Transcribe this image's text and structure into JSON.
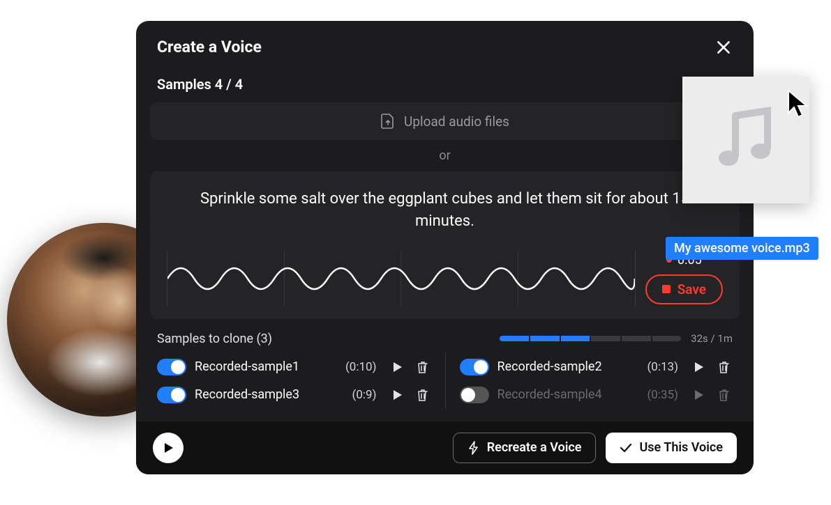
{
  "modal": {
    "title": "Create a Voice",
    "samples_label": "Samples 4 / 4",
    "upload_label": "Upload audio files",
    "or_label": "or",
    "prompt_text": "Sprinkle some salt over the eggplant cubes and let them sit for about 15 minutes.",
    "timer": "0:05",
    "save_label": "Save",
    "clone_title": "Samples to clone (3)",
    "progress_label": "32s / 1m",
    "samples": [
      {
        "name": "Recorded-sample1",
        "duration": "(0:10)",
        "enabled": true
      },
      {
        "name": "Recorded-sample2",
        "duration": "(0:13)",
        "enabled": true
      },
      {
        "name": "Recorded-sample3",
        "duration": "(0:9)",
        "enabled": true
      },
      {
        "name": "Recorded-sample4",
        "duration": "(0:35)",
        "enabled": false
      }
    ],
    "footer": {
      "recreate_label": "Recreate a Voice",
      "use_label": "Use This Voice"
    }
  },
  "drag": {
    "filename": "My awesome voice.mp3"
  }
}
